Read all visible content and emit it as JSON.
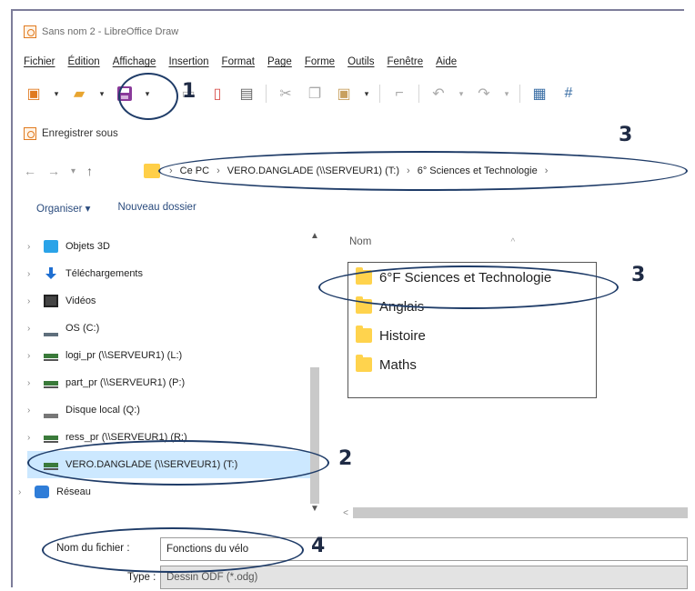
{
  "window": {
    "title": "Sans nom 2 - LibreOffice Draw"
  },
  "menu": [
    "Fichier",
    "Édition",
    "Affichage",
    "Insertion",
    "Format",
    "Page",
    "Forme",
    "Outils",
    "Fenêtre",
    "Aide"
  ],
  "dialog": {
    "title": "Enregistrer sous",
    "breadcrumb": [
      "Ce PC",
      "VERO.DANGLADE (\\\\SERVEUR1) (T:)",
      "6° Sciences et Technologie"
    ],
    "commands": {
      "organize": "Organiser ▾",
      "new_folder": "Nouveau dossier"
    },
    "tree": [
      {
        "label": "Objets 3D",
        "icon": "cube-icon"
      },
      {
        "label": "Téléchargements",
        "icon": "download-icon"
      },
      {
        "label": "Vidéos",
        "icon": "video-icon"
      },
      {
        "label": "OS (C:)",
        "icon": "drive-icon"
      },
      {
        "label": "logi_pr (\\\\SERVEUR1) (L:)",
        "icon": "network-drive-icon"
      },
      {
        "label": "part_pr (\\\\SERVEUR1) (P:)",
        "icon": "network-drive-icon"
      },
      {
        "label": "Disque local (Q:)",
        "icon": "drive-icon"
      },
      {
        "label": "ress_pr (\\\\SERVEUR1) (R:)",
        "icon": "network-drive-icon"
      },
      {
        "label": "VERO.DANGLADE (\\\\SERVEUR1) (T:)",
        "icon": "network-drive-icon",
        "selected": true
      },
      {
        "label": "Réseau",
        "icon": "network-icon"
      }
    ],
    "column_header": "Nom",
    "files": [
      "6°F Sciences et Technologie",
      "Anglais",
      "Histoire",
      "Maths"
    ],
    "filename_label": "Nom du fichier :",
    "filename_value": "Fonctions du vélo",
    "type_label": "Type :",
    "type_value": "Dessin ODF (*.odg)"
  },
  "annotations": {
    "n1": "1",
    "n2": "2",
    "n3a": "3",
    "n3b": "3",
    "n4": "4"
  },
  "colors": {
    "annotation": "#1f3c68",
    "folder": "#ffd34d",
    "selected": "#cce8ff"
  }
}
